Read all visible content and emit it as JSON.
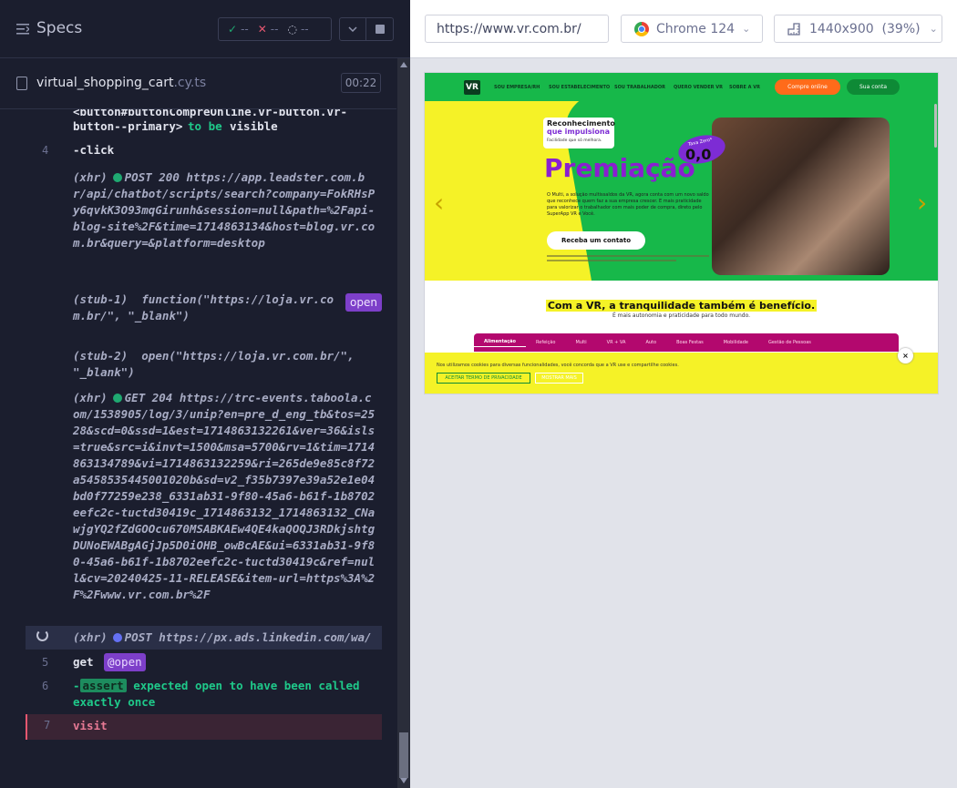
{
  "specs": {
    "title": "Specs",
    "stats": {
      "passed": "--",
      "failed": "--",
      "pending": "--"
    }
  },
  "file": {
    "name": "virtual_shopping_cart",
    "ext": ".cy.ts",
    "duration": "00:22"
  },
  "log": {
    "top_selector_1": "<button#buttonCompreOnline.vr-button.vr-",
    "top_selector_2": "button--primary>",
    "top_to_be": "to be",
    "top_visible": "visible",
    "rows": [
      {
        "num": "4",
        "text": "-click"
      },
      {
        "label": "(xhr)",
        "method": "POST 200",
        "url": "https://app.leadster.com.br/api/chatbot/scripts/search?company=FokRHsPy6qvkK3O93mqGirunh&session=null&path=%2Fapi-blog-site%2F&time=1714863134&host=blog.vr.com.br&query=&platform=desktop"
      },
      {
        "label": "(stub-1)",
        "text": "function(\"https://loja.vr.com.br/\", \"_blank\")",
        "badge": "open"
      },
      {
        "label": "(stub-2)",
        "text": "open(\"https://loja.vr.com.br/\", \"_blank\")"
      },
      {
        "label": "(xhr)",
        "method": "GET 204",
        "url": "https://trc-events.taboola.com/1538905/log/3/unip?en=pre_d_eng_tb&tos=2528&scd=0&ssd=1&est=1714863132261&ver=36&isls=true&src=i&invt=1500&msa=5700&rv=1&tim=1714863134789&vi=1714863132259&ri=265de9e85c8f72a5458535445001020b&sd=v2_f35b7397e39a52e1e04bd0f77259e238_6331ab31-9f80-45a6-b61f-1b8702eefc2c-tuctd30419c_1714863132_1714863132_CNawjgYQ2fZdGOOcu670MSABKAEw4QE4kaQOQJ3RDkjshtgDUNoEWABgAGjJp5D0iOHB_owBcAE&ui=6331ab31-9f80-45a6-b61f-1b8702eefc2c-tuctd30419c&ref=null&cv=20240425-11-RELEASE&item-url=https%3A%2F%2Fwww.vr.com.br%2F"
      },
      {
        "label": "(xhr)",
        "method": "POST",
        "url": "https://px.ads.linkedin.com/wa/"
      },
      {
        "num": "5",
        "text": "get",
        "tag": "@open"
      },
      {
        "num": "6",
        "assert": "assert",
        "text": "expected open to have been called exactly once"
      },
      {
        "num": "7",
        "text": "visit"
      }
    ]
  },
  "browser": {
    "url": "https://www.vr.com.br/",
    "name": "Chrome 124",
    "viewport": "1440x900",
    "zoom": "(39%)"
  },
  "aut": {
    "nav": [
      "SOU EMPRESA/RH",
      "SOU ESTABELECIMENTO",
      "SOU TRABALHADOR",
      "QUERO VENDER VR",
      "SOBRE A VR"
    ],
    "buy": "Compre online",
    "account": "Sua conta",
    "headline_1": "Reconhecimento",
    "headline_2": "que impulsiona",
    "headline_sub": "Facilidade que só melhora.",
    "title": "Premiação",
    "zero_badge": "Taxa Zero*",
    "zero_val": "0,0",
    "body": "O Multi, a solução multissaldos da VR, agora conta com um novo saldo que reconhece quem faz a sua empresa crescer. E mais praticidade para valorizar o trabalhador com mais poder de compra, direto pelo SuperApp VR e Você.",
    "cta": "Receba um contato",
    "tagline": "Com a VR, a tranquilidade também é benefício.",
    "tagline_sub": "É mais autonomia e praticidade para todo mundo.",
    "tabs": [
      "Alimentação",
      "Refeição",
      "Multi",
      "VR + VA",
      "Auto",
      "Boas Festas",
      "Mobilidade",
      "Gestão de Pessoas"
    ],
    "cookie_text": "Nos utilizamos cookies para diversas funcionalidades, você concorda que a VR use e compartilhe cookies.",
    "cookie_accept": "ACEITAR TERMO DE PRIVACIDADE",
    "cookie_more": "MOSTRAR MAIS",
    "cookie_close": "×"
  },
  "colors": {
    "pass": "#1fa971",
    "fail": "#e45770",
    "accent": "#7d3fc9"
  }
}
